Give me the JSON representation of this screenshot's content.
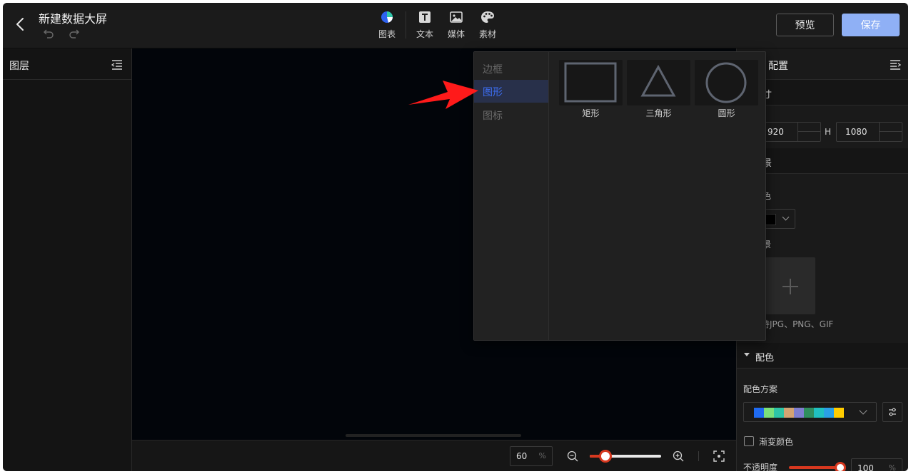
{
  "header": {
    "title": "新建数据大屏",
    "tools": [
      {
        "label": "图表",
        "icon": "pie-chart-icon"
      },
      {
        "label": "文本",
        "icon": "text-icon"
      },
      {
        "label": "媒体",
        "icon": "image-icon"
      },
      {
        "label": "素材",
        "icon": "palette-icon"
      }
    ],
    "preview_label": "预览",
    "save_label": "保存"
  },
  "left_panel": {
    "title": "图层"
  },
  "popup": {
    "nav": [
      "边框",
      "图形",
      "图标"
    ],
    "active_nav": "图形",
    "shapes": [
      {
        "label": "矩形",
        "icon": "rectangle-icon"
      },
      {
        "label": "三角形",
        "icon": "triangle-icon"
      },
      {
        "label": "圆形",
        "icon": "circle-icon"
      }
    ]
  },
  "right_panel": {
    "title_partial": "配置",
    "size_section_partial": "寸",
    "width_partial": "920",
    "height_label": "H",
    "height": "1080",
    "bg_section_partial": "景",
    "bg_color_label_partial": "色",
    "bg_image_label_partial": "景",
    "upload_hint_partial": "持JPG、PNG、GIF",
    "color_section": "配色",
    "palette_label": "配色方案",
    "palette_colors": [
      "#1f6bf2",
      "#7be07b",
      "#2ec4a6",
      "#d4a373",
      "#7f7fd0",
      "#2f8f5f",
      "#20c0c0",
      "#2aa0e6",
      "#ffcc00"
    ],
    "gradient_label": "渐变颜色",
    "opacity_label": "不透明度",
    "opacity_value": "100",
    "opacity_unit": "%"
  },
  "canvas": {
    "zoom_value": "60",
    "zoom_unit": "%",
    "zoom_fraction": 0.22
  },
  "colors": {
    "accent": "#3d6ef2",
    "save_button": "#8fb0f5",
    "slider": "#d7381f",
    "arrow": "#ff1a1a"
  }
}
